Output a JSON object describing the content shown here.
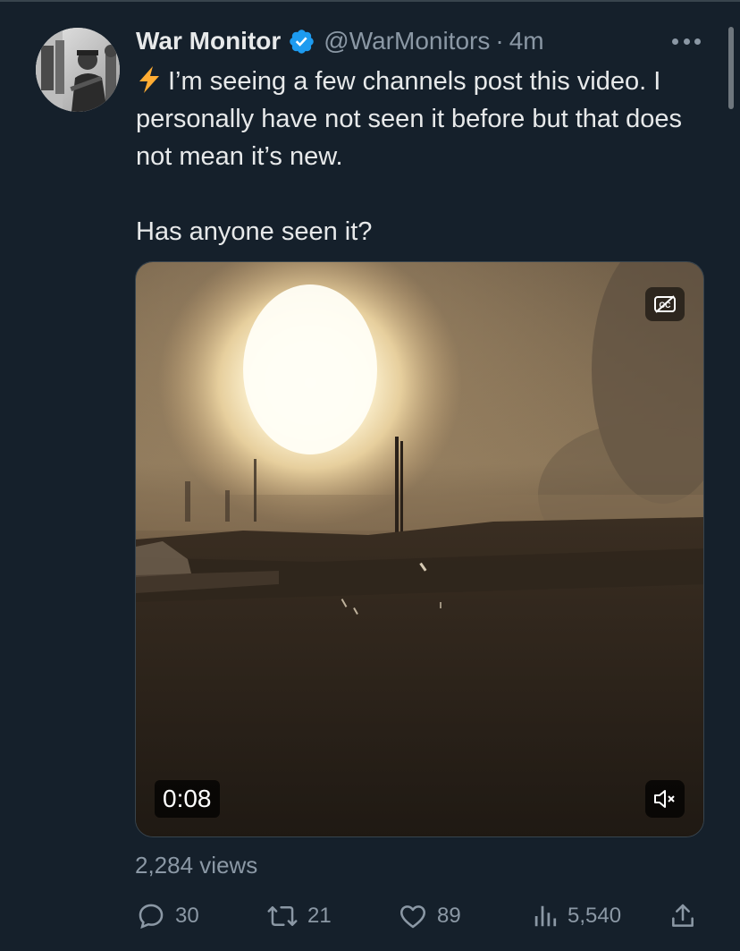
{
  "tweet": {
    "author_name": "War Monitor",
    "verified_icon": "verified-badge-icon",
    "handle": "@WarMonitors",
    "separator": "·",
    "time": "4m",
    "text_line1": "I’m seeing a few channels post this video. I personally have not seen it before but that does not mean it’s new.",
    "text_line2": "Has anyone seen it?",
    "views": "2,284 views"
  },
  "media": {
    "duration": "0:08",
    "cc_icon": "captions-off-icon",
    "mute_icon": "muted-speaker-icon"
  },
  "actions": {
    "replies": "30",
    "retweets": "21",
    "likes": "89",
    "analytics": "5,540"
  },
  "colors": {
    "background": "#15202b",
    "text": "#e7e9ea",
    "secondary_text": "#8b98a5",
    "verified": "#1d9bf0",
    "lightning": "#ffac33"
  }
}
